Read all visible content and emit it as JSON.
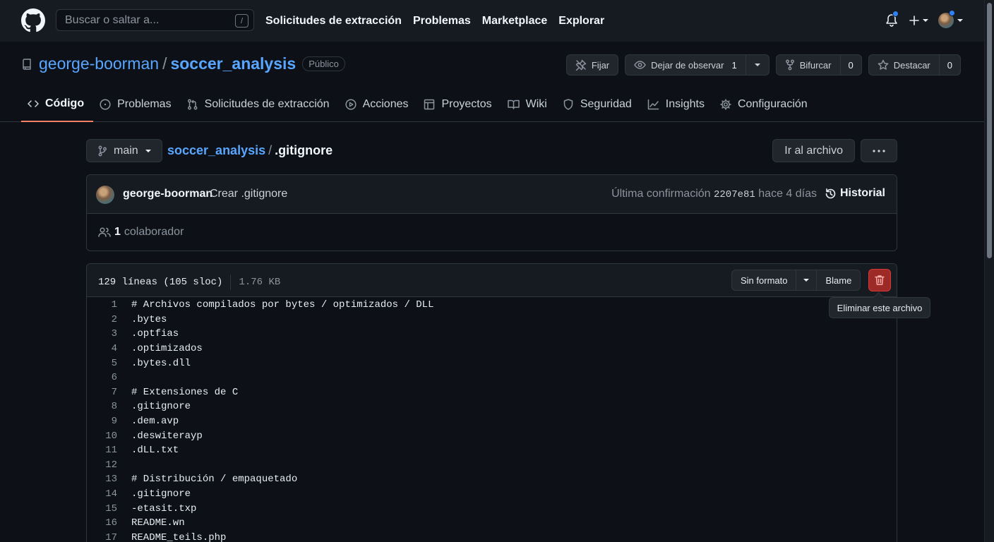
{
  "header": {
    "search_placeholder": "Buscar o saltar a...",
    "search_shortcut": "/",
    "nav": [
      "Solicitudes de extracción",
      "Problemas",
      "Marketplace",
      "Explorar"
    ]
  },
  "repo": {
    "owner": "george-boorman",
    "separator": "/",
    "name": "soccer_analysis",
    "visibility": "Público",
    "actions": {
      "pin": "Fijar",
      "unwatch": "Dejar de observar",
      "watch_count": "1",
      "fork": "Bifurcar",
      "fork_count": "0",
      "star": "Destacar",
      "star_count": "0"
    },
    "tabs": [
      "Código",
      "Problemas",
      "Solicitudes de extracción",
      "Acciones",
      "Proyectos",
      "Wiki",
      "Seguridad",
      "Insights",
      "Configuración"
    ]
  },
  "file": {
    "branch": "main",
    "breadcrumb_repo": "soccer_analysis",
    "breadcrumb_sep": "/",
    "breadcrumb_file": ".gitignore",
    "goto_label": "Ir al archivo",
    "commit": {
      "author": "george-boorman",
      "message": "Crear .gitignore",
      "last_label": "Última confirmación",
      "sha": "2207e81",
      "ago": "hace 4 días",
      "history": "Historial"
    },
    "contributors_count": "1",
    "contributors_label": "colaborador",
    "lines_info": "129 líneas (105 sloc)",
    "size": "1.76 KB",
    "raw_label": "Sin formato",
    "blame_label": "Blame",
    "delete_tooltip": "Eliminar este archivo",
    "lines": [
      {
        "n": "1",
        "t": "# Archivos compilados por bytes / optimizados / DLL"
      },
      {
        "n": "2",
        "t": ".bytes"
      },
      {
        "n": "3",
        "t": ".optfias"
      },
      {
        "n": "4",
        "t": ".optimizados"
      },
      {
        "n": "5",
        "t": ".bytes.dll"
      },
      {
        "n": "6",
        "t": ""
      },
      {
        "n": "7",
        "t": "# Extensiones de C"
      },
      {
        "n": "8",
        "t": ".gitignore"
      },
      {
        "n": "9",
        "t": ".dem.avp"
      },
      {
        "n": "10",
        "t": ".deswiterayp"
      },
      {
        "n": "11",
        "t": ".dLL.txt"
      },
      {
        "n": "12",
        "t": ""
      },
      {
        "n": "13",
        "t": "# Distribución / empaquetado"
      },
      {
        "n": "14",
        "t": ".gitignore"
      },
      {
        "n": "15",
        "t": "-etasit.txp"
      },
      {
        "n": "16",
        "t": "README.wn"
      },
      {
        "n": "17",
        "t": "README_teils.php"
      }
    ]
  }
}
